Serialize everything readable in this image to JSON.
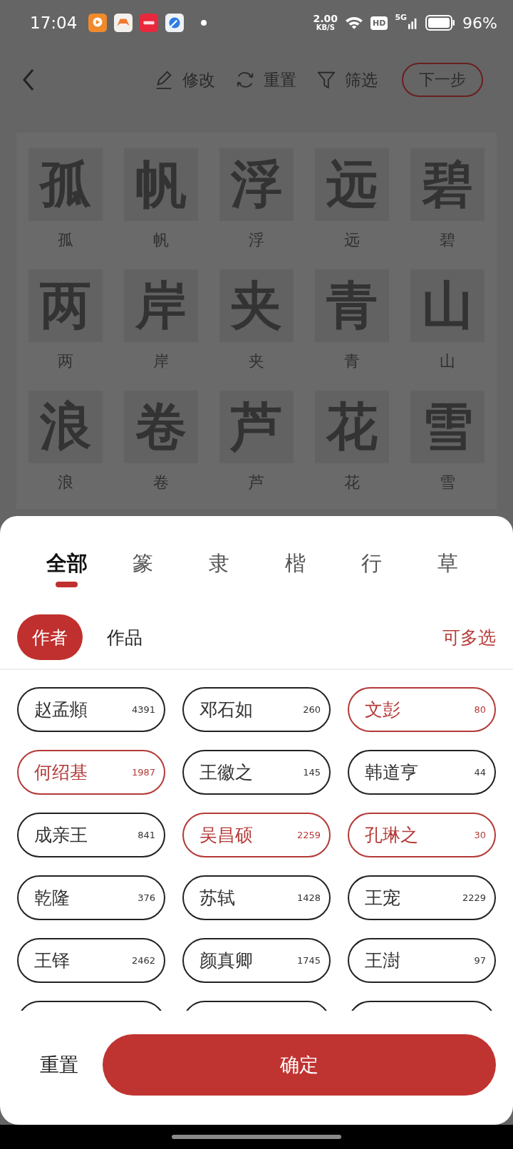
{
  "status_bar": {
    "time": "17:04",
    "speed": "2.00",
    "speed_unit": "KB/S",
    "hd": "HD",
    "network": "5G",
    "battery": "96%"
  },
  "toolbar": {
    "actions": [
      {
        "kind": "edit",
        "label": "修改"
      },
      {
        "kind": "reset",
        "label": "重置"
      },
      {
        "kind": "filter",
        "label": "筛选"
      }
    ],
    "next_button": "下一步"
  },
  "characters": [
    {
      "glyph": "孤",
      "label": "孤"
    },
    {
      "glyph": "帆",
      "label": "帆"
    },
    {
      "glyph": "浮",
      "label": "浮"
    },
    {
      "glyph": "远",
      "label": "远"
    },
    {
      "glyph": "碧",
      "label": "碧"
    },
    {
      "glyph": "两",
      "label": "两"
    },
    {
      "glyph": "岸",
      "label": "岸"
    },
    {
      "glyph": "夹",
      "label": "夹"
    },
    {
      "glyph": "青",
      "label": "青"
    },
    {
      "glyph": "山",
      "label": "山"
    },
    {
      "glyph": "浪",
      "label": "浪"
    },
    {
      "glyph": "卷",
      "label": "卷"
    },
    {
      "glyph": "芦",
      "label": "芦"
    },
    {
      "glyph": "花",
      "label": "花"
    },
    {
      "glyph": "雪",
      "label": "雪"
    }
  ],
  "sheet": {
    "tabs": [
      {
        "label": "全部",
        "selected": true
      },
      {
        "label": "篆",
        "selected": false
      },
      {
        "label": "隶",
        "selected": false
      },
      {
        "label": "楷",
        "selected": false
      },
      {
        "label": "行",
        "selected": false
      },
      {
        "label": "草",
        "selected": false
      }
    ],
    "modes": [
      {
        "label": "作者",
        "selected": true
      },
      {
        "label": "作品",
        "selected": false
      }
    ],
    "hint": "可多选",
    "authors": [
      {
        "name": "赵孟頫",
        "count": "4391",
        "selected": false
      },
      {
        "name": "邓石如",
        "count": "260",
        "selected": false
      },
      {
        "name": "文彭",
        "count": "80",
        "selected": true
      },
      {
        "name": "何绍基",
        "count": "1987",
        "selected": true
      },
      {
        "name": "王徽之",
        "count": "145",
        "selected": false
      },
      {
        "name": "韩道亨",
        "count": "44",
        "selected": false
      },
      {
        "name": "成亲王",
        "count": "841",
        "selected": false
      },
      {
        "name": "吴昌硕",
        "count": "2259",
        "selected": true
      },
      {
        "name": "孔琳之",
        "count": "30",
        "selected": true
      },
      {
        "name": "乾隆",
        "count": "376",
        "selected": false
      },
      {
        "name": "苏轼",
        "count": "1428",
        "selected": false
      },
      {
        "name": "王宠",
        "count": "2229",
        "selected": false
      },
      {
        "name": "王铎",
        "count": "2462",
        "selected": false
      },
      {
        "name": "颜真卿",
        "count": "1745",
        "selected": false
      },
      {
        "name": "王澍",
        "count": "97",
        "selected": false
      }
    ],
    "partial_chips": [
      {
        "selected": false
      },
      {
        "selected": false
      },
      {
        "selected": false
      }
    ],
    "reset_button": "重置",
    "confirm_button": "确定"
  }
}
